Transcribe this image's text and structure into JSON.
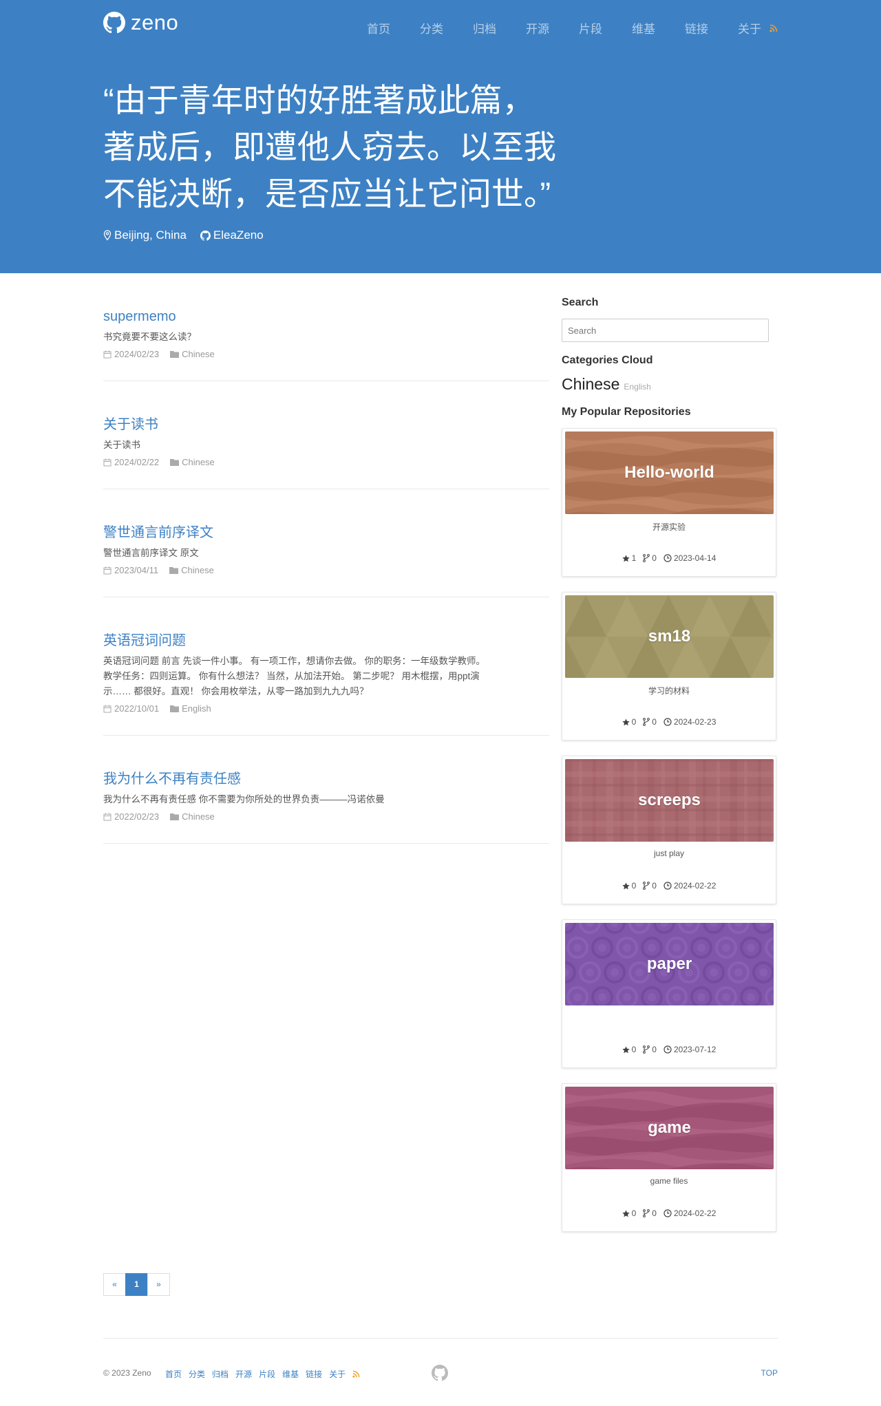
{
  "nav": {
    "brand": "zeno",
    "items": [
      "首页",
      "分类",
      "归档",
      "开源",
      "片段",
      "维基",
      "链接",
      "关于"
    ],
    "rss_icon": "rss-icon"
  },
  "hero": {
    "quote_lines": [
      "“由于青年时的好胜著成此篇，",
      "著成后，即遭他人窃去。以至我",
      "不能决断，是否应当让它问世。”"
    ],
    "location": "Beijing, China",
    "github_user": "EleaZeno"
  },
  "posts": [
    {
      "title": "supermemo",
      "excerpt": "书究竟要不要这么读？",
      "date": "2024/02/23",
      "category": "Chinese"
    },
    {
      "title": "关于读书",
      "excerpt": "关于读书",
      "date": "2024/02/22",
      "category": "Chinese"
    },
    {
      "title": "警世通言前序译文",
      "excerpt": "警世通言前序译文 原文",
      "date": "2023/04/11",
      "category": "Chinese"
    },
    {
      "title": "英语冠词问题",
      "excerpt": "英语冠词问题 前言 先谈一件小事。 有一项工作，想请你去做。 你的职务：一年级数学教师。教学任务：四则运算。 你有什么想法？ 当然，从加法开始。 第二步呢？ 用木棍摆，用ppt演示…… 都很好。直观！ 你会用枚举法，从零一路加到九九九吗？",
      "date": "2022/10/01",
      "category": "English"
    },
    {
      "title": "我为什么不再有责任感",
      "excerpt": "我为什么不再有责任感 你不需要为你所处的世界负责———冯诺依曼",
      "date": "2022/02/23",
      "category": "Chinese"
    }
  ],
  "sidebar": {
    "search_heading": "Search",
    "search_placeholder": "Search",
    "categories_heading": "Categories Cloud",
    "categories": [
      {
        "name": "Chinese",
        "size": "large"
      },
      {
        "name": "English",
        "size": "small"
      }
    ],
    "repos_heading": "My Popular Repositories",
    "repos": [
      {
        "name": "Hello-world",
        "desc": "开源实验",
        "stars": "1",
        "forks": "0",
        "updated": "2023-04-14",
        "color": "#b57a5a",
        "pattern": "waves"
      },
      {
        "name": "sm18",
        "desc": "学习的材料",
        "stars": "0",
        "forks": "0",
        "updated": "2024-02-23",
        "color": "#a59a6a",
        "pattern": "triangles"
      },
      {
        "name": "screeps",
        "desc": "just play",
        "stars": "0",
        "forks": "0",
        "updated": "2024-02-22",
        "color": "#a96a6f",
        "pattern": "plaid"
      },
      {
        "name": "paper",
        "desc": "",
        "stars": "0",
        "forks": "0",
        "updated": "2023-07-12",
        "color": "#7f56aa",
        "pattern": "circles"
      },
      {
        "name": "game",
        "desc": "game files",
        "stars": "0",
        "forks": "0",
        "updated": "2024-02-22",
        "color": "#a55779",
        "pattern": "waves"
      }
    ]
  },
  "pagination": {
    "prev": "«",
    "current": "1",
    "next": "»"
  },
  "footer": {
    "copyright": "© 2023 Zeno",
    "links": [
      "首页",
      "分类",
      "归档",
      "开源",
      "片段",
      "维基",
      "链接",
      "关于"
    ],
    "top": "TOP"
  },
  "colors": {
    "brand": "#3d81c4",
    "link": "#3d81c4",
    "rss": "#f0a030"
  }
}
